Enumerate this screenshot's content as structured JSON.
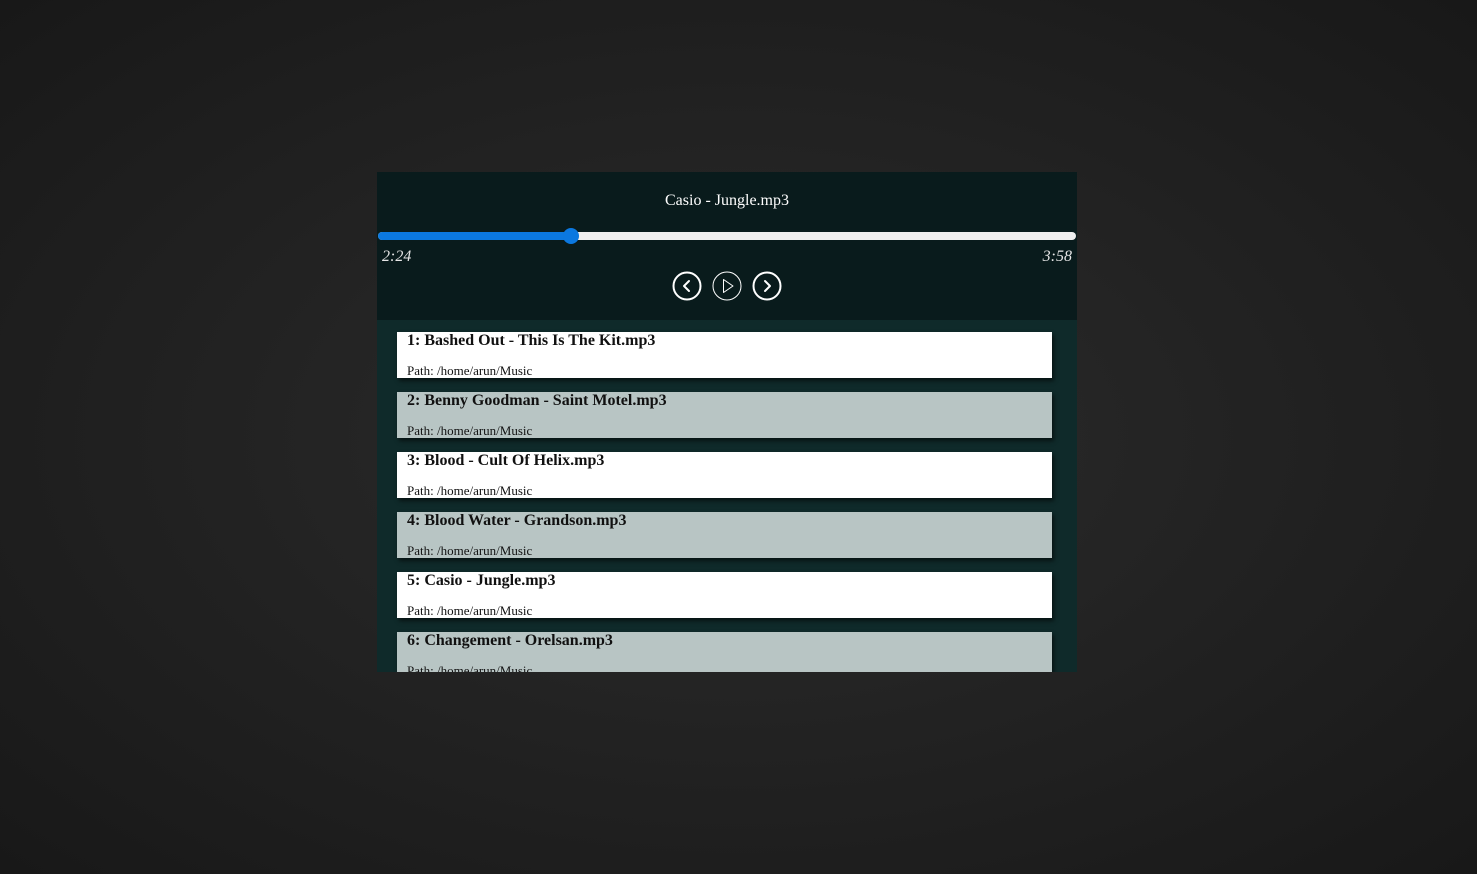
{
  "now_playing": {
    "title": "Casio - Jungle.mp3",
    "current_time": "2:24",
    "total_time": "3:58",
    "progress": 0.277
  },
  "controls": {
    "prev_icon": "chevron-left-icon",
    "play_icon": "play-icon",
    "next_icon": "chevron-right-icon"
  },
  "colors": {
    "accent": "#0b78e0",
    "header_bg": "#091b1c",
    "list_bg": "#0f2a2a",
    "row_light": "#ffffff",
    "row_dark": "#b8c5c4"
  },
  "playlist": [
    {
      "name": "1: Bashed Out - This Is The Kit.mp3",
      "path": "Path: /home/arun/Music"
    },
    {
      "name": "2: Benny Goodman - Saint Motel.mp3",
      "path": "Path: /home/arun/Music"
    },
    {
      "name": "3: Blood - Cult Of Helix.mp3",
      "path": "Path: /home/arun/Music"
    },
    {
      "name": "4: Blood Water - Grandson.mp3",
      "path": "Path: /home/arun/Music"
    },
    {
      "name": "5: Casio - Jungle.mp3",
      "path": "Path: /home/arun/Music"
    },
    {
      "name": "6: Changement - Orelsan.mp3",
      "path": "Path: /home/arun/Music"
    }
  ]
}
